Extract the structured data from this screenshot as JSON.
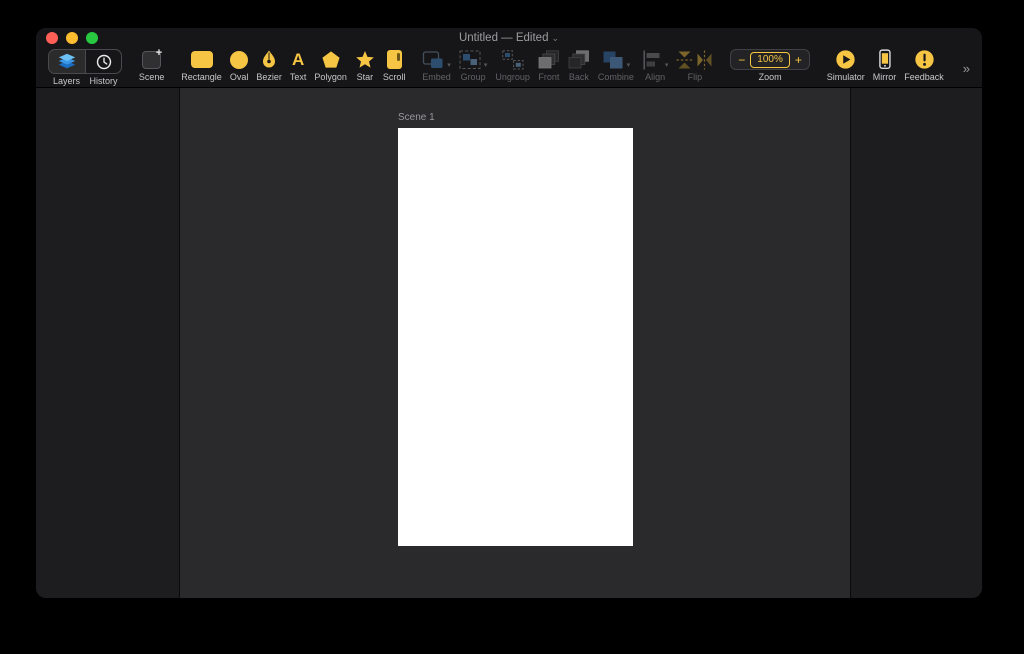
{
  "window": {
    "title": "Untitled — Edited",
    "proxy_chevron": "⌄"
  },
  "toolbar": {
    "panels": [
      {
        "label": "Layers",
        "icon": "layers-icon",
        "enabled": true,
        "active": true
      },
      {
        "label": "History",
        "icon": "history-icon",
        "enabled": true,
        "active": false
      }
    ],
    "scene": {
      "label": "Scene",
      "icon": "scene-add-icon",
      "enabled": true
    },
    "shapes": [
      {
        "label": "Rectangle",
        "icon": "rectangle-icon",
        "enabled": true
      },
      {
        "label": "Oval",
        "icon": "oval-icon",
        "enabled": true
      },
      {
        "label": "Bezier",
        "icon": "bezier-pen-icon",
        "enabled": true
      },
      {
        "label": "Text",
        "icon": "text-icon",
        "enabled": true
      },
      {
        "label": "Polygon",
        "icon": "polygon-icon",
        "enabled": true
      },
      {
        "label": "Star",
        "icon": "star-icon",
        "enabled": true
      },
      {
        "label": "Scroll",
        "icon": "scroll-icon",
        "enabled": true
      }
    ],
    "arrange": [
      {
        "label": "Embed",
        "icon": "embed-icon",
        "enabled": false,
        "has_menu": true
      },
      {
        "label": "Group",
        "icon": "group-icon",
        "enabled": false,
        "has_menu": true
      },
      {
        "label": "Ungroup",
        "icon": "ungroup-icon",
        "enabled": false,
        "has_menu": false
      },
      {
        "label": "Front",
        "icon": "front-icon",
        "enabled": false,
        "has_menu": false
      },
      {
        "label": "Back",
        "icon": "back-icon",
        "enabled": false,
        "has_menu": false
      },
      {
        "label": "Combine",
        "icon": "combine-icon",
        "enabled": false,
        "has_menu": true
      },
      {
        "label": "Align",
        "icon": "align-icon",
        "enabled": false,
        "has_menu": true
      },
      {
        "label": "Flip",
        "icon": "flip-vertical-icon flip-horizontal-icon",
        "enabled": false,
        "has_menu": false
      }
    ],
    "zoom": {
      "label": "Zoom",
      "decrease": "−",
      "value": "100%",
      "increase": "+"
    },
    "run": [
      {
        "label": "Simulator",
        "icon": "simulator-play-icon",
        "enabled": true
      },
      {
        "label": "Mirror",
        "icon": "mirror-device-icon",
        "enabled": true
      },
      {
        "label": "Feedback",
        "icon": "feedback-icon",
        "enabled": true
      }
    ],
    "overflow_chevron": "»"
  },
  "canvas": {
    "scene_label": "Scene 1"
  },
  "glyphs": {
    "text_tool": "A",
    "scene_plus": "+",
    "menu_caret": "▾"
  },
  "colors": {
    "accent_yellow": "#F5C543",
    "layers_blue": "#3B97E8",
    "traffic_red": "#FF5F57",
    "traffic_yellow": "#FEBC2E",
    "traffic_green": "#28C840",
    "chrome_bg": "#161618",
    "panel_bg": "#1D1D1F",
    "canvas_bg": "#2A2A2C",
    "artboard_bg": "#FFFFFF"
  }
}
